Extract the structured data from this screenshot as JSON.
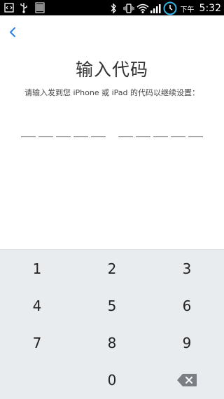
{
  "status_bar": {
    "left_icons": [
      "code-icon",
      "usb-icon",
      "barcode-icon"
    ],
    "right_icons": [
      "bluetooth-icon",
      "vibrate-icon",
      "wifi-icon",
      "signal-icon",
      "clock-icon"
    ],
    "ampm": "下午",
    "time": "5:32"
  },
  "nav": {
    "back_icon": "chevron-left-icon",
    "accent_color": "#2a7fe6"
  },
  "header": {
    "title": "输入代码",
    "subtitle": "请输入发到您 iPhone 或 iPad 的代码以继续设置："
  },
  "code": {
    "group_sizes": [
      5,
      5
    ],
    "entered": ""
  },
  "keypad": {
    "keys": [
      [
        "1",
        "2",
        "3"
      ],
      [
        "4",
        "5",
        "6"
      ],
      [
        "7",
        "8",
        "9"
      ],
      [
        "",
        "0",
        ""
      ]
    ],
    "backspace_icon": "backspace-icon",
    "background": "#e9ecef"
  }
}
